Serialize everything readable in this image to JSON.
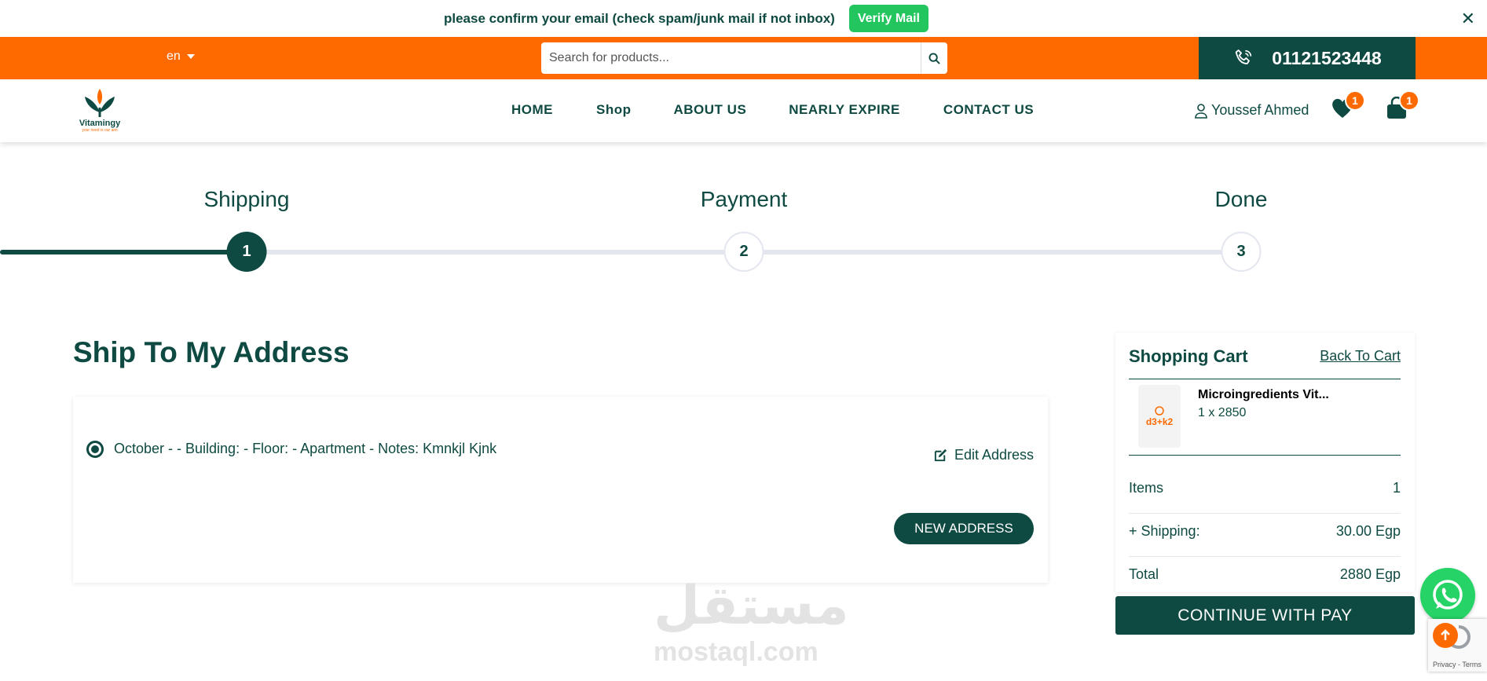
{
  "verify_bar": {
    "message": "please confirm your email (check spam/junk mail if not inbox)",
    "button": "Verify Mail",
    "close": "✕"
  },
  "topbar": {
    "language": "en",
    "search_placeholder": "Search for products...",
    "phone": "01121523448"
  },
  "brand": {
    "name": "Vitamingy",
    "tagline": "your need is our aim"
  },
  "nav": {
    "items": [
      "HOME",
      "Shop",
      "ABOUT US",
      "NEARLY EXPIRE",
      "CONTACT US"
    ],
    "user_name": "Youssef Ahmed",
    "wishlist_count": "1",
    "cart_count": "1"
  },
  "steps": [
    {
      "label": "Shipping",
      "number": "1"
    },
    {
      "label": "Payment",
      "number": "2"
    },
    {
      "label": "Done",
      "number": "3"
    }
  ],
  "address": {
    "title": "Ship To My Address",
    "line": "October - - Building: - Floor: - Apartment - Notes: Kmnkjl Kjnk",
    "edit_label": "Edit Address",
    "new_label": "NEW ADDRESS"
  },
  "cart": {
    "title": "Shopping Cart",
    "back_label": "Back To Cart",
    "product_name": "Microingredients Vit...",
    "product_qty": "1 x 2850",
    "product_image_label": "d3+k2",
    "rows": [
      {
        "label": "Items",
        "value": "1"
      },
      {
        "label": "+ Shipping:",
        "value": "30.00 Egp"
      },
      {
        "label": "Total",
        "value": "2880 Egp"
      }
    ],
    "pay_label": "CONTINUE WITH PAY"
  },
  "watermark": {
    "arabic": "مستقل",
    "latin": "mostaql.com"
  },
  "recaptcha": {
    "links": "Privacy - Terms"
  },
  "colors": {
    "primary": "#0e4a42",
    "accent": "#ff6a00",
    "verify": "#22c55e",
    "whatsapp": "#25d366"
  }
}
